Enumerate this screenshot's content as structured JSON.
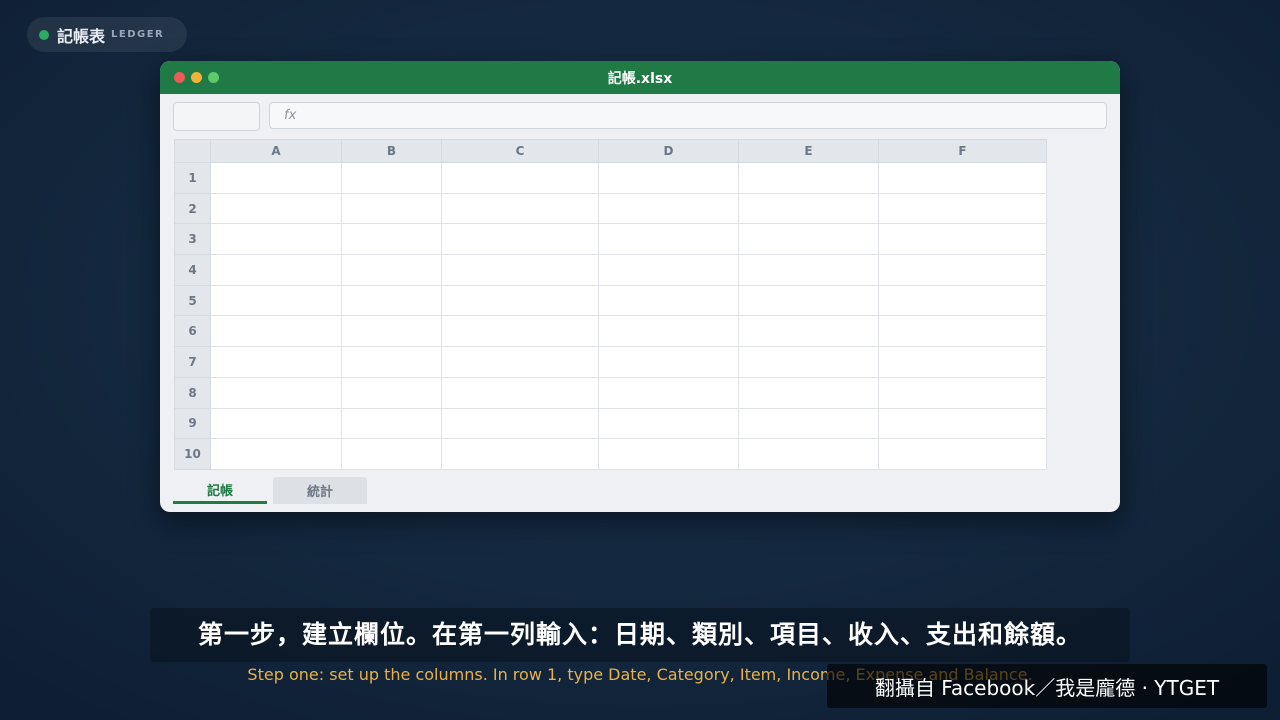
{
  "badge": {
    "title": "記帳表",
    "subtitle": "LEDGER",
    "dot_color": "#2faa62"
  },
  "window": {
    "filename": "記帳.xlsx",
    "titlebar_color": "#1f7a45",
    "formula_bar": {
      "name_box_value": "",
      "fx_label": "fx",
      "value": ""
    },
    "columns": [
      "A",
      "B",
      "C",
      "D",
      "E",
      "F"
    ],
    "rows": [
      "1",
      "2",
      "3",
      "4",
      "5",
      "6",
      "7",
      "8",
      "9",
      "10"
    ],
    "sheets": [
      {
        "label": "記帳",
        "active": true
      },
      {
        "label": "統計",
        "active": false
      }
    ]
  },
  "subtitles": {
    "chinese": "第一步，建立欄位。在第一列輸入：日期、類別、項目、收入、支出和餘額。",
    "english": "Step one: set up the columns. In row 1, type Date, Category, Item, Income, Expense and Balance."
  },
  "watermark": "翻攝自 Facebook／我是龐德 · YTGET"
}
